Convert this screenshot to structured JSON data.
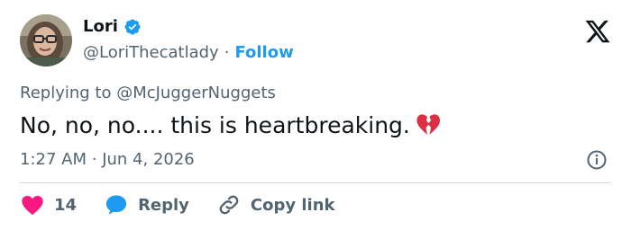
{
  "author": {
    "name": "Lori",
    "handle": "@LoriThecatlady",
    "separator": "·",
    "follow_label": "Follow"
  },
  "reply_context": "Replying to @McJuggerNuggets",
  "tweet": {
    "text": "No, no, no.... this is heartbreaking."
  },
  "timestamp": {
    "time": "1:27 AM",
    "separator": "·",
    "date": "Jun 4, 2026"
  },
  "actions": {
    "like_count": "14",
    "reply_label": "Reply",
    "copy_label": "Copy link"
  },
  "colors": {
    "accent": "#1d9bf0",
    "like": "#f91880",
    "secondary_text": "#536471",
    "primary_text": "#0f1419"
  },
  "icons": [
    "verified-badge-icon",
    "x-logo-icon",
    "broken-heart-icon",
    "info-icon",
    "heart-icon",
    "speech-bubble-icon",
    "link-icon"
  ]
}
